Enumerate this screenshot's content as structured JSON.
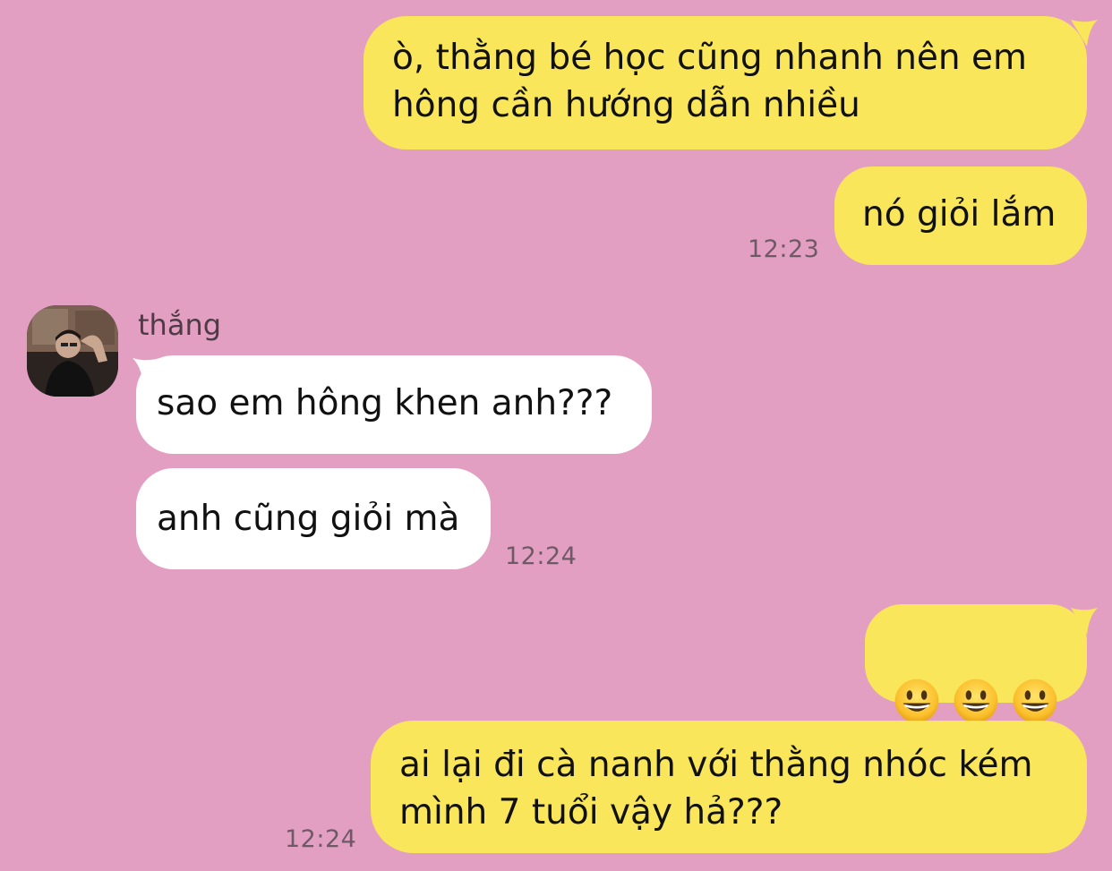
{
  "contact": {
    "name": "thắng"
  },
  "colors": {
    "background": "#e39fc2",
    "outgoing_bubble": "#f9e65a",
    "incoming_bubble": "#ffffff",
    "timestamp": "#6e5a66"
  },
  "messages": [
    {
      "direction": "out",
      "text": "ò, thằng bé học cũng nhanh nên em\nhông cần hướng dẫn nhiều"
    },
    {
      "direction": "out",
      "text": "nó giỏi lắm",
      "time": "12:23"
    },
    {
      "direction": "in",
      "text": "sao em hông khen anh???"
    },
    {
      "direction": "in",
      "text": "anh cũng giỏi mà",
      "time": "12:24"
    },
    {
      "direction": "out",
      "emoji": [
        "grinning-face",
        "grinning-face",
        "grinning-face"
      ]
    },
    {
      "direction": "out",
      "text": "ai lại đi cà nanh với thằng nhóc kém\nmình 7 tuổi vậy hả???",
      "time": "12:24"
    }
  ]
}
